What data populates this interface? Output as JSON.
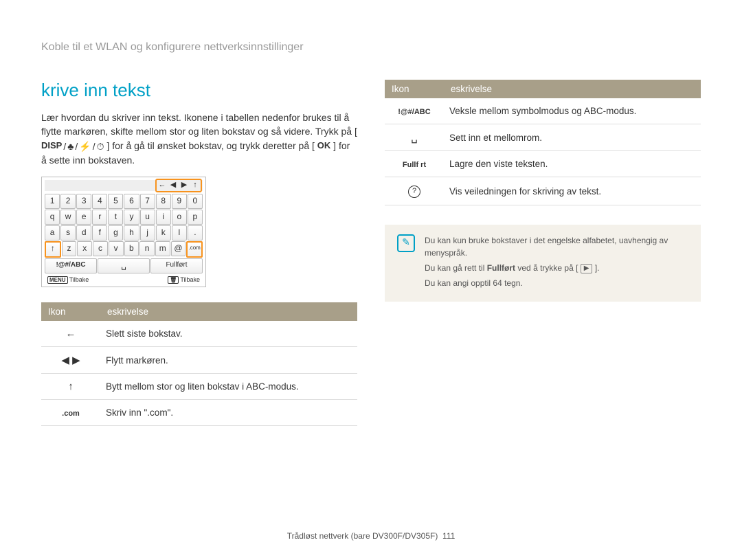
{
  "breadcrumb": "Koble til et WLAN og konfigurere nettverksinnstillinger",
  "title": "krive inn tekst",
  "para1a": "Lær hvordan du skriver inn tekst. Ikonene i tabellen nedenfor brukes til å flytte markøren, skifte mellom stor og liten bokstav og så videre. Trykk på [",
  "disp": "DISP",
  "para1b": "] for å gå til ønsket bokstav, og trykk deretter på [",
  "ok": "OK",
  "para1c": "] for å sette inn bokstaven.",
  "kbd": {
    "tool_arrows": [
      "←",
      "◀",
      "▶",
      "↑"
    ],
    "row_num": [
      "1",
      "2",
      "3",
      "4",
      "5",
      "6",
      "7",
      "8",
      "9",
      "0"
    ],
    "row_q": [
      "q",
      "w",
      "e",
      "r",
      "t",
      "y",
      "u",
      "i",
      "o",
      "p"
    ],
    "row_a": [
      "a",
      "s",
      "d",
      "f",
      "g",
      "h",
      "j",
      "k",
      "l",
      "."
    ],
    "row_z": [
      "↑",
      "z",
      "x",
      "c",
      "v",
      "b",
      "n",
      "m",
      "@",
      ".com"
    ],
    "row_bot": [
      "!@#/ABC",
      "␣",
      "Fullført"
    ],
    "foot_menu": "Tilbake",
    "foot_trash": "Tilbake"
  },
  "th_icon": "Ikon",
  "th_desc": "eskrivelse",
  "left_rows": [
    {
      "icon": "←",
      "cls": "",
      "desc": "Slett siste bokstav."
    },
    {
      "icon": "◀  ▶",
      "cls": "",
      "desc": "Flytt markøren."
    },
    {
      "icon": "↑",
      "cls": "",
      "desc": "Bytt mellom stor og liten bokstav i ABC-modus."
    },
    {
      "icon": ".com",
      "cls": "small",
      "desc": "Skriv inn \".com\"."
    }
  ],
  "right_rows": [
    {
      "icon": "!@#/ABC",
      "cls": "small",
      "desc": "Veksle mellom symbolmodus og ABC-modus."
    },
    {
      "icon": "␣",
      "cls": "",
      "desc": "Sett inn et mellomrom."
    },
    {
      "icon_text": "Fullf  rt",
      "cls": "small",
      "desc": "Lagre den viste teksten."
    },
    {
      "icon_html": "q",
      "desc": "Vis veiledningen for skriving av tekst."
    }
  ],
  "note": {
    "l1": "Du kan kun bruke bokstaver i det engelske alfabetet, uavhengig av menyspråk.",
    "l2a": "Du kan gå rett til ",
    "l2b": "Fullført",
    "l2c": " ved å trykke på [",
    "l2d": "].",
    "l3": "Du kan angi opptil 64 tegn."
  },
  "footer_a": "Trådløst nettverk (bare DV300F/DV305F)",
  "footer_b": "111"
}
